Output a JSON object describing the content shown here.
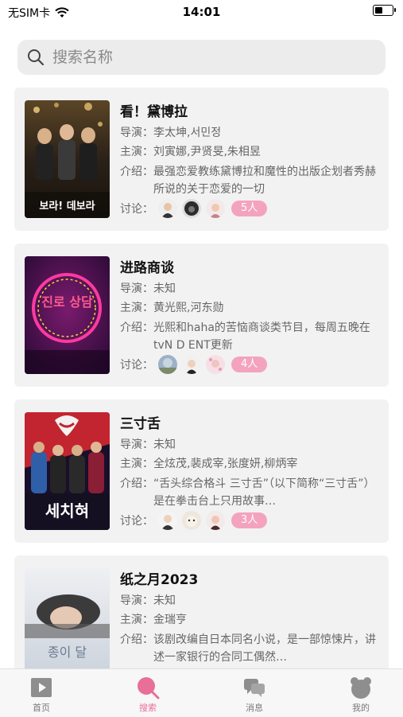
{
  "status": {
    "carrier": "无SIM卡",
    "time": "14:01",
    "battery_level": 0.45
  },
  "search": {
    "placeholder": "搜索名称",
    "value": ""
  },
  "labels": {
    "director": "导演：",
    "cast": "主演：",
    "intro": "介绍：",
    "discuss": "讨论："
  },
  "shows": [
    {
      "title": "看！黛博拉",
      "director": "李太坤,서민정",
      "cast": "刘寅娜,尹贤旻,朱相昱",
      "intro": "最强恋爱教练黛博拉和魔性的出版企划者秀赫所说的关于恋爱的一切",
      "discuss_count": "5人",
      "poster_text": "보라! 데보라",
      "poster_colors": [
        "#2a2118",
        "#b88a3a"
      ]
    },
    {
      "title": "进路商谈",
      "director": "未知",
      "cast": "黄光熙,河东勋",
      "intro": "光熙和haha的苦恼商谈类节目，每周五晚在tvN D ENT更新",
      "discuss_count": "4人",
      "poster_text": "진로 상담",
      "poster_colors": [
        "#3a0f4a",
        "#b0207a"
      ]
    },
    {
      "title": "三寸舌",
      "director": "未知",
      "cast": "全炫茂,裴成宰,张度妍,柳炳宰",
      "intro": "“舌头综合格斗 三寸舌”（以下简称“三寸舌”）是在拳击台上只用故事…",
      "discuss_count": "3人",
      "poster_text": "세치혀",
      "poster_colors": [
        "#1a0f2a",
        "#c2252f"
      ]
    },
    {
      "title": "纸之月2023",
      "director": "未知",
      "cast": "金瑞亨",
      "intro": "该剧改编自日本同名小说，是一部惊悚片，讲述一家银行的合同工偶然…",
      "discuss_count": "",
      "poster_text": "종이 달",
      "poster_colors": [
        "#d9dde3",
        "#8c98a8"
      ]
    }
  ],
  "tabs": [
    {
      "label": "首页",
      "icon": "play-icon"
    },
    {
      "label": "搜索",
      "icon": "search-icon"
    },
    {
      "label": "消息",
      "icon": "chat-icon"
    },
    {
      "label": "我的",
      "icon": "bear-icon"
    }
  ],
  "colors": {
    "accent": "#e86f98",
    "badge": "#f4a3bf",
    "card_bg": "#f2f2f2"
  }
}
